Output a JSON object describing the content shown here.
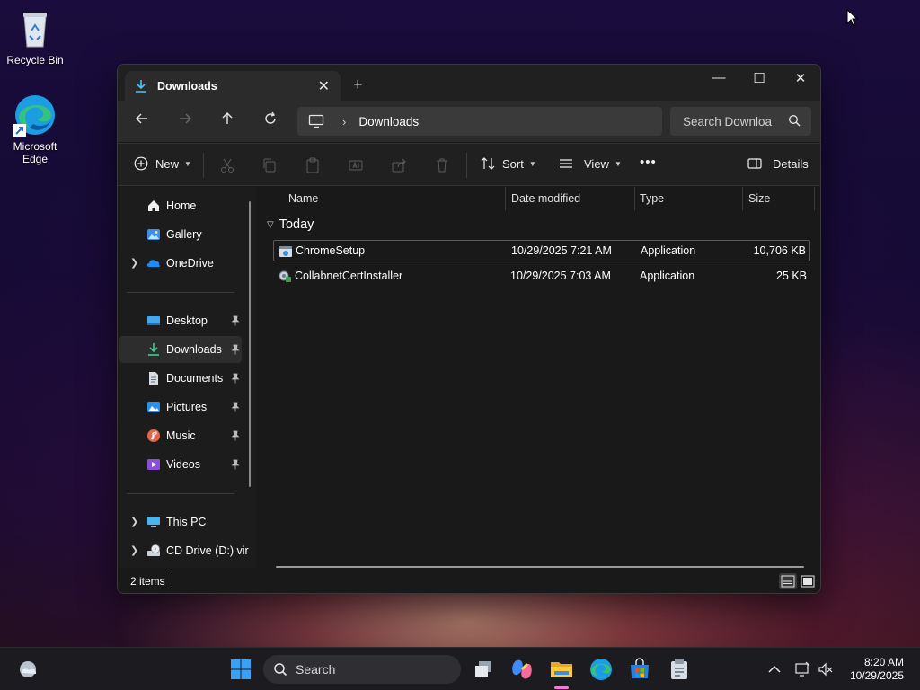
{
  "desktop": {
    "icons": [
      {
        "label": "Recycle Bin",
        "icon": "recycle-bin-icon"
      },
      {
        "label": "Microsoft Edge",
        "label_line1": "Microsoft",
        "label_line2": "Edge",
        "icon": "edge-icon"
      }
    ]
  },
  "window": {
    "tab_title": "Downloads",
    "controls": {
      "minimize": "—",
      "maximize": "☐",
      "close": "✕"
    },
    "new_tab": "+",
    "address": {
      "location_icon": "this-pc-icon",
      "separator": "›",
      "crumb": "Downloads"
    },
    "search": {
      "placeholder": "Search Downloa"
    },
    "toolbar": {
      "new_label": "New",
      "sort_label": "Sort",
      "view_label": "View",
      "more_label": "•••",
      "details_label": "Details"
    },
    "sidebar": {
      "items": [
        {
          "label": "Home",
          "icon": "home-icon"
        },
        {
          "label": "Gallery",
          "icon": "gallery-icon"
        },
        {
          "label": "OneDrive",
          "icon": "onedrive-icon"
        },
        {
          "label": "Desktop",
          "icon": "desktop-icon",
          "pinned": true
        },
        {
          "label": "Downloads",
          "icon": "downloads-icon",
          "pinned": true,
          "active": true
        },
        {
          "label": "Documents",
          "icon": "documents-icon",
          "pinned": true
        },
        {
          "label": "Pictures",
          "icon": "pictures-icon",
          "pinned": true
        },
        {
          "label": "Music",
          "icon": "music-icon",
          "pinned": true
        },
        {
          "label": "Videos",
          "icon": "videos-icon",
          "pinned": true
        },
        {
          "label": "This PC",
          "icon": "this-pc-icon"
        },
        {
          "label": "CD Drive (D:) vir",
          "icon": "cd-drive-icon"
        }
      ]
    },
    "columns": {
      "name": "Name",
      "date": "Date modified",
      "type": "Type",
      "size": "Size"
    },
    "group_label": "Today",
    "files": [
      {
        "name": "ChromeSetup",
        "date": "10/29/2025 7:21 AM",
        "type": "Application",
        "size": "10,706 KB",
        "selected": true
      },
      {
        "name": "CollabnetCertInstaller",
        "date": "10/29/2025 7:03 AM",
        "type": "Application",
        "size": "25 KB",
        "selected": false
      }
    ],
    "status": {
      "count": "2 items"
    }
  },
  "taskbar": {
    "search_label": "Search",
    "pinned": [
      "start-icon",
      "task-view-icon",
      "copilot-icon",
      "file-explorer-icon",
      "edge-icon",
      "store-icon",
      "installer-icon"
    ],
    "clock": {
      "time": "8:20 AM",
      "date": "10/29/2025"
    }
  },
  "colors": {
    "accent": "#4cc2ff",
    "window_bg": "#191919",
    "active_indicator": "#f27bd8"
  }
}
